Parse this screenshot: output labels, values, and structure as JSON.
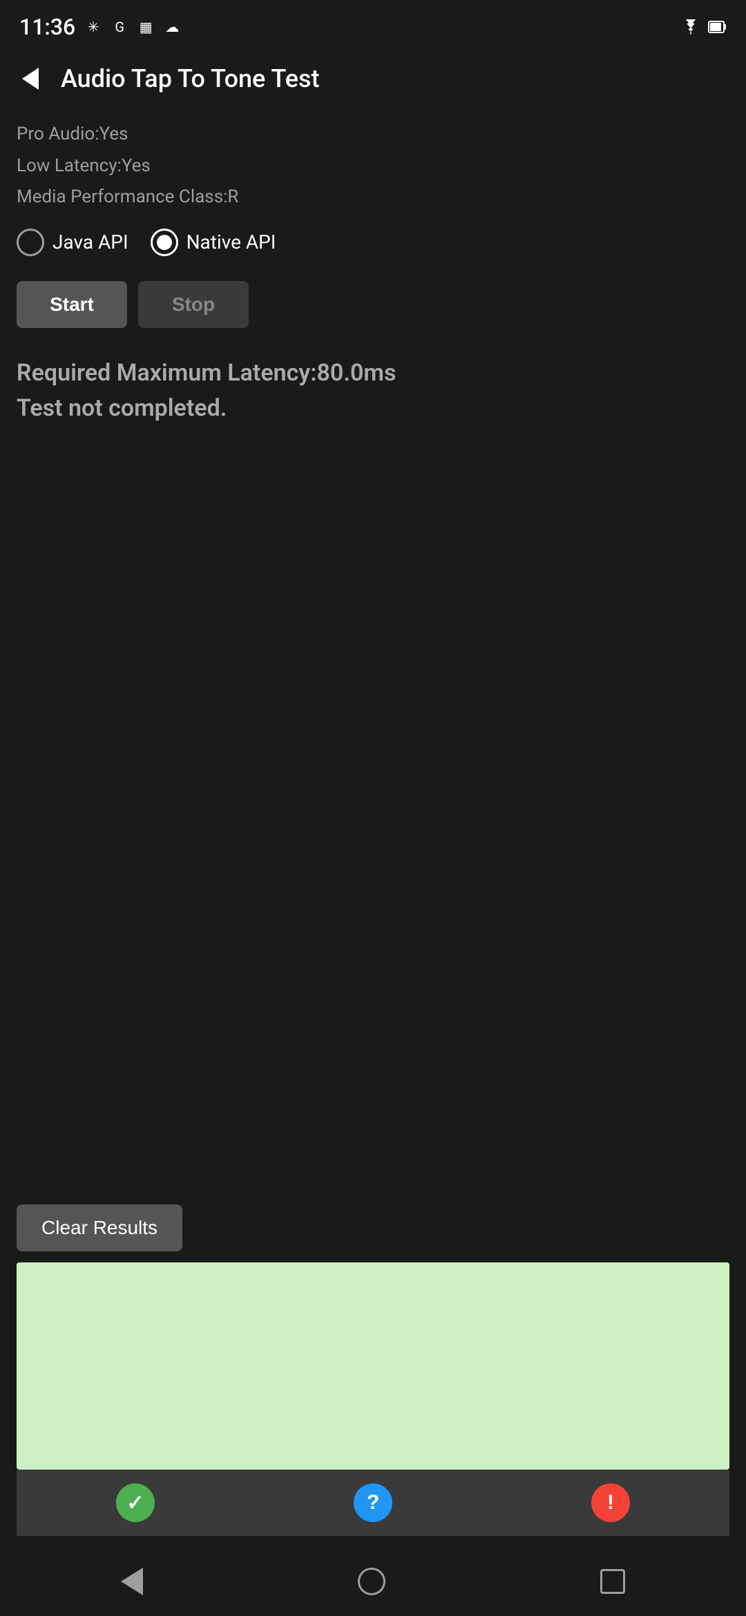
{
  "statusBar": {
    "time": "11:36",
    "icons": [
      "fan-icon",
      "google-icon",
      "calendar-icon",
      "cloud-icon"
    ]
  },
  "toolbar": {
    "title": "Audio Tap To Tone Test",
    "backLabel": "Back"
  },
  "info": {
    "proAudio": "Pro Audio:Yes",
    "lowLatency": "Low Latency:Yes",
    "mediaPerformance": "Media Performance Class:R"
  },
  "radioGroup": {
    "options": [
      {
        "id": "java-api",
        "label": "Java API",
        "selected": false
      },
      {
        "id": "native-api",
        "label": "Native API",
        "selected": true
      }
    ]
  },
  "buttons": {
    "start": "Start",
    "stop": "Stop"
  },
  "statusText": {
    "line1": "Required Maximum Latency:80.0ms",
    "line2": "Test not completed."
  },
  "clearResults": "Clear Results",
  "resultBox": {
    "backgroundColor": "#ccf0c4"
  },
  "iconButtons": [
    {
      "id": "pass-icon",
      "type": "checkmark",
      "color": "green",
      "symbol": "✓"
    },
    {
      "id": "info-icon",
      "type": "question",
      "color": "blue",
      "symbol": "?"
    },
    {
      "id": "warning-icon",
      "type": "exclamation",
      "color": "red",
      "symbol": "!"
    }
  ],
  "navBar": {
    "back": "back",
    "home": "home",
    "recents": "recents"
  }
}
